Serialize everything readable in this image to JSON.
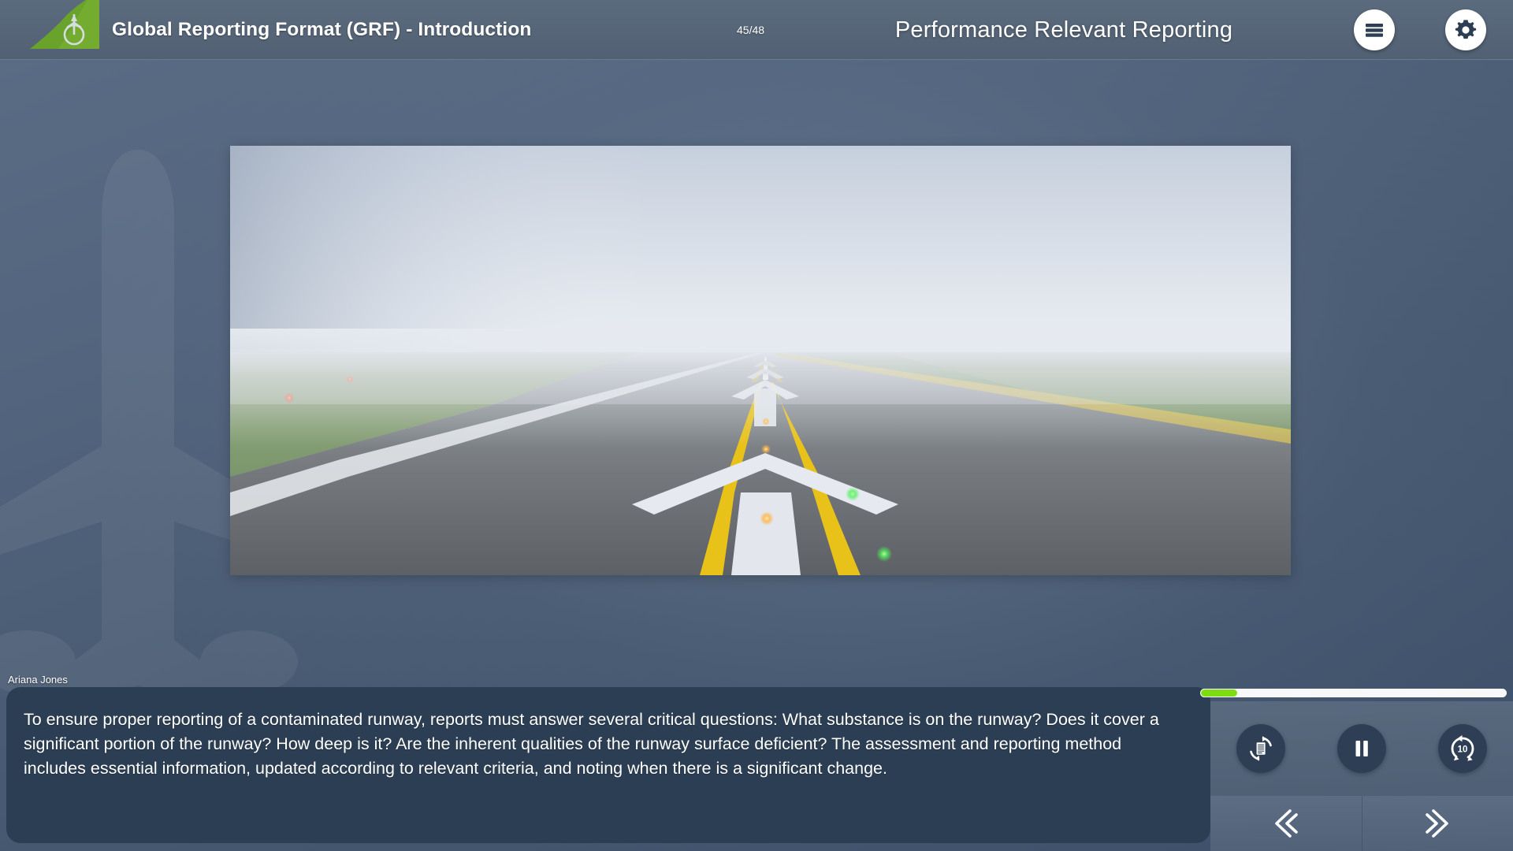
{
  "header": {
    "course_title": "Global Reporting Format (GRF) - Introduction",
    "page_counter": "45/48",
    "slide_title": "Performance Relevant Reporting",
    "logo_name": "airline-tail-fin-logo",
    "menu_icon": "hamburger-menu-icon",
    "gear_icon": "gear-icon",
    "background_color": "#566678",
    "logo_color": "#6aa32b"
  },
  "slide": {
    "image_alt": "foggy-runway-view-with-chevron-markings",
    "scene": {
      "sky_color": "#ced5e0",
      "fog_color": "#dfe4ec",
      "grass_color": "#8fa47e",
      "asphalt_color": "#6e7276",
      "marking_color": "#eef1f5",
      "centerline_yellow": "#e8c219",
      "edge_light_red": "#ff5a3c",
      "edge_light_green": "#4cf05a",
      "edge_light_amber": "#ffb347"
    }
  },
  "caption": {
    "speaker": "Ariana Jones",
    "text": "To ensure proper reporting of a contaminated runway, reports must answer several critical questions: What substance is on the runway? Does it cover a significant portion of the runway? How deep is it? Are the inherent qualities of the runway surface deficient? The assessment and reporting method includes essential information, updated according to relevant criteria, and noting when there is a significant change.",
    "background_color": "#2c3e53"
  },
  "player": {
    "progress_percent": 12,
    "progress_fill_color": "#7ddd12",
    "transcript_icon": "transcript-replay-icon",
    "playback_icon": "pause-icon",
    "rewind_icon": "rewind-10-seconds-icon",
    "rewind_label": "10",
    "prev_icon": "double-chevron-left-icon",
    "next_icon": "double-chevron-right-icon"
  }
}
